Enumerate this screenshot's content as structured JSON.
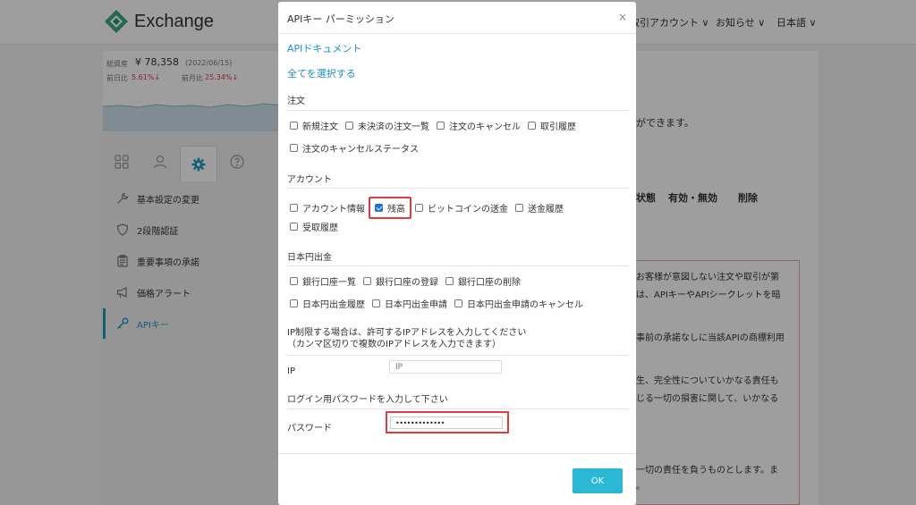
{
  "header": {
    "logo_text": "Exchange",
    "nav": [
      "取引アカウント ∨",
      "お知らせ ∨",
      "日本語 ∨"
    ]
  },
  "assets": {
    "total_label": "総資産",
    "total_value": "¥ 78,358",
    "date": "(2022/06/15)",
    "prev_day_label": "前日比",
    "prev_day_value": "5.61%↓",
    "prev_month_label": "前月比",
    "prev_month_value": "25.34%↓"
  },
  "sidebar": {
    "items": [
      {
        "label": "基本設定の変更",
        "icon": "wrench-icon"
      },
      {
        "label": "2段階認証",
        "icon": "shield-icon"
      },
      {
        "label": "重要事項の承諾",
        "icon": "clipboard-icon"
      },
      {
        "label": "価格アラート",
        "icon": "megaphone-icon"
      },
      {
        "label": "APIキー",
        "icon": "key-icon"
      }
    ]
  },
  "background": {
    "intro_tail": "ができます。",
    "col_status": "状態",
    "col_enabled": "有効・無効",
    "col_delete": "削除",
    "notice_lines": [
      "お客様が意図しない注文や取引が第",
      "は、APIキーやAPIシークレットを暗",
      "事前の承諾なしに当該APIの商標利用",
      "生、完全性についていかなる責任も",
      "じる一切の損害に関して、いかなる",
      "一切の責任を負うものとします。ま",
      "。"
    ]
  },
  "modal": {
    "title": "APIキー パーミッション",
    "close": "×",
    "doc_link": "APIドキュメント",
    "select_all": "全てを選択する",
    "sections": {
      "order": {
        "title": "注文",
        "row1": [
          {
            "label": "新規注文",
            "checked": false
          },
          {
            "label": "未決済の注文一覧",
            "checked": false
          },
          {
            "label": "注文のキャンセル",
            "checked": false
          },
          {
            "label": "取引履歴",
            "checked": false
          }
        ],
        "row2": [
          {
            "label": "注文のキャンセルステータス",
            "checked": false
          }
        ]
      },
      "account": {
        "title": "アカウント",
        "row1": [
          {
            "label": "アカウント情報",
            "checked": false
          },
          {
            "label": "残高",
            "checked": true
          },
          {
            "label": "ビットコインの送金",
            "checked": false
          },
          {
            "label": "送金履歴",
            "checked": false
          }
        ],
        "row2": [
          {
            "label": "受取履歴",
            "checked": false
          }
        ]
      },
      "jpy": {
        "title": "日本円出金",
        "row1": [
          {
            "label": "銀行口座一覧",
            "checked": false
          },
          {
            "label": "銀行口座の登録",
            "checked": false
          },
          {
            "label": "銀行口座の削除",
            "checked": false
          }
        ],
        "row2": [
          {
            "label": "日本円出金履歴",
            "checked": false
          },
          {
            "label": "日本円出金申請",
            "checked": false
          },
          {
            "label": "日本円出金申請のキャンセル",
            "checked": false
          }
        ]
      }
    },
    "ip_note_line1": "IP制限する場合は、許可するIPアドレスを入力してください",
    "ip_note_line2": "（カンマ区切りで複数のIPアドレスを入力できます）",
    "ip_label": "IP",
    "ip_placeholder": "IP",
    "password_note": "ログイン用パスワードを入力して下さい",
    "password_label": "パスワード",
    "password_value": "•••••••••••••",
    "ok_label": "OK"
  }
}
